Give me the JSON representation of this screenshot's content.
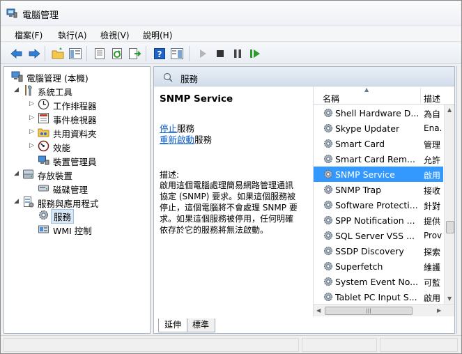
{
  "window": {
    "title": "電腦管理"
  },
  "menu": [
    "檔案(F)",
    "執行(A)",
    "檢視(V)",
    "說明(H)"
  ],
  "tree": {
    "root": "電腦管理 (本機)",
    "system_tools": "系統工具",
    "task_scheduler": "工作排程器",
    "event_viewer": "事件檢視器",
    "shared_folders": "共用資料夾",
    "performance": "效能",
    "device_manager": "裝置管理員",
    "storage": "存放裝置",
    "disk_management": "磁碟管理",
    "services_apps": "服務與應用程式",
    "services": "服務",
    "wmi": "WMI 控制"
  },
  "services_panel": {
    "header": "服務",
    "selected_service": "SNMP Service",
    "stop_link": "停止",
    "stop_suffix": "服務",
    "restart_link": "重新啟動",
    "restart_suffix": "服務",
    "desc_label": "描述:",
    "desc_lines": [
      "啟用這個電腦處理簡易網路管理通訊",
      "協定 (SNMP) 要求。如果這個服務被",
      "停止，這個電腦將不會處理 SNMP 要",
      "求。如果這個服務被停用，任何明確",
      "依存於它的服務將無法啟動。"
    ]
  },
  "list": {
    "col_name": "名稱",
    "col_desc": "描述",
    "rows": [
      {
        "name": "Shell Hardware D...",
        "desc": "為自"
      },
      {
        "name": "Skype Updater",
        "desc": "Ena."
      },
      {
        "name": "Smart Card",
        "desc": "管理"
      },
      {
        "name": "Smart Card Rem...",
        "desc": "允許"
      },
      {
        "name": "SNMP Service",
        "desc": "啟用"
      },
      {
        "name": "SNMP Trap",
        "desc": "接收"
      },
      {
        "name": "Software Protecti...",
        "desc": "針對"
      },
      {
        "name": "SPP Notification ...",
        "desc": "提供"
      },
      {
        "name": "SQL Server VSS ...",
        "desc": "Prov"
      },
      {
        "name": "SSDP Discovery",
        "desc": "探索"
      },
      {
        "name": "Superfetch",
        "desc": "維護"
      },
      {
        "name": "System Event No...",
        "desc": "可監"
      },
      {
        "name": "Tablet PC Input S...",
        "desc": "啟用"
      }
    ],
    "selected_index": 4
  },
  "tabs": [
    "延伸",
    "標準"
  ],
  "colors": {
    "selection": "#3399ff",
    "link": "#0b5cc7"
  }
}
